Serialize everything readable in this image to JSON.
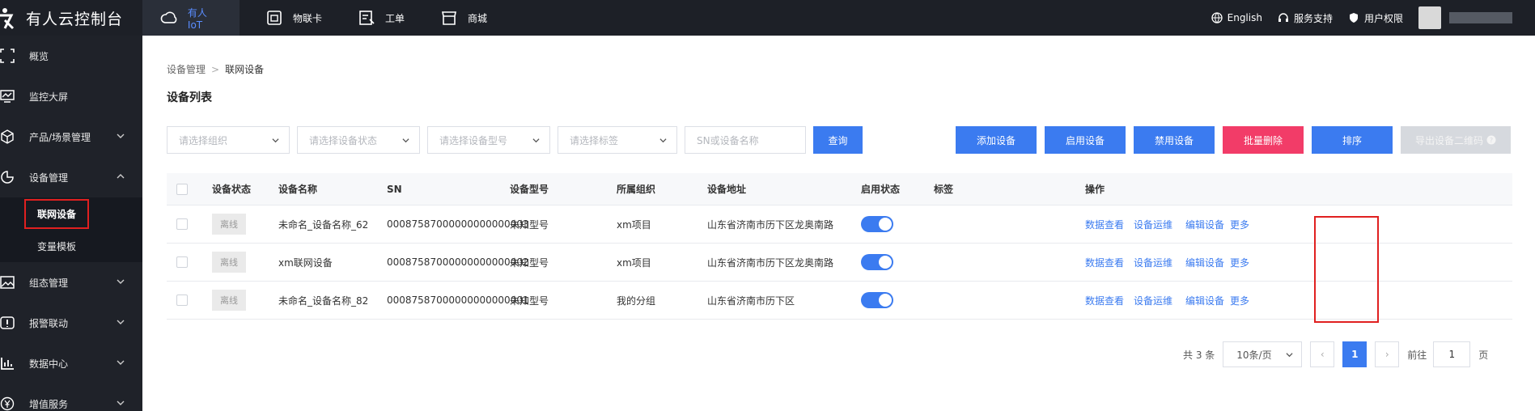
{
  "brand": {
    "title": "有人云控制台"
  },
  "topnav": [
    {
      "label": "有人IoT",
      "icon": "cloud-icon",
      "active": true
    },
    {
      "label": "物联卡",
      "icon": "sim-card-icon"
    },
    {
      "label": "工单",
      "icon": "ticket-icon"
    },
    {
      "label": "商城",
      "icon": "store-icon"
    }
  ],
  "topright": {
    "language": "English",
    "support": "服务支持",
    "permission": "用户权限"
  },
  "sidebar": {
    "items": [
      {
        "label": "概览",
        "icon": "overview-icon"
      },
      {
        "label": "监控大屏",
        "icon": "monitor-icon"
      },
      {
        "label": "产品/场景管理",
        "icon": "cube-icon"
      },
      {
        "label": "设备管理",
        "icon": "pie-icon"
      },
      {
        "label": "组态管理",
        "icon": "image-icon"
      },
      {
        "label": "报警联动",
        "icon": "alarm-icon"
      },
      {
        "label": "数据中心",
        "icon": "bar-chart-icon"
      },
      {
        "label": "增值服务",
        "icon": "yen-icon"
      }
    ],
    "sub": [
      "联网设备",
      "变量模板"
    ]
  },
  "breadcrumb": {
    "parent": "设备管理",
    "current": "联网设备"
  },
  "page_title": "设备列表",
  "filters": {
    "org_placeholder": "请选择组织",
    "status_placeholder": "请选择设备状态",
    "model_placeholder": "请选择设备型号",
    "tag_placeholder": "请选择标签",
    "search_placeholder": "SN或设备名称",
    "query": "查询"
  },
  "actions": {
    "add": "添加设备",
    "enable": "启用设备",
    "disable": "禁用设备",
    "batch_delete": "批量删除",
    "sort": "排序",
    "export_qr": "导出设备二维码"
  },
  "table": {
    "headers": [
      "设备状态",
      "设备名称",
      "SN",
      "设备型号",
      "所属组织",
      "设备地址",
      "启用状态",
      "标签",
      "操作"
    ],
    "rows": [
      {
        "status": "离线",
        "name": "未命名_设备名称_62",
        "sn": "00087587000000000000003",
        "model": "未知型号",
        "org": "xm项目",
        "address": "山东省济南市历下区龙奥南路",
        "enabled": true
      },
      {
        "status": "离线",
        "name": "xm联网设备",
        "sn": "00087587000000000000002",
        "model": "未知型号",
        "org": "xm项目",
        "address": "山东省济南市历下区龙奥南路",
        "enabled": true
      },
      {
        "status": "离线",
        "name": "未命名_设备名称_82",
        "sn": "00087587000000000000001",
        "model": "未知型号",
        "org": "我的分组",
        "address": "山东省济南市历下区",
        "enabled": true
      }
    ],
    "ops": {
      "view_data": "数据查看",
      "maintain": "设备运维",
      "edit": "编辑设备",
      "more": "更多"
    }
  },
  "pagination": {
    "total": "共 3 条",
    "page_size": "10条/页",
    "current": "1",
    "goto_label": "前往",
    "goto_value": "1",
    "page_suffix": "页"
  },
  "colors": {
    "primary": "#3b7bf0",
    "danger": "#f23c68",
    "highlight": "#e02020"
  }
}
